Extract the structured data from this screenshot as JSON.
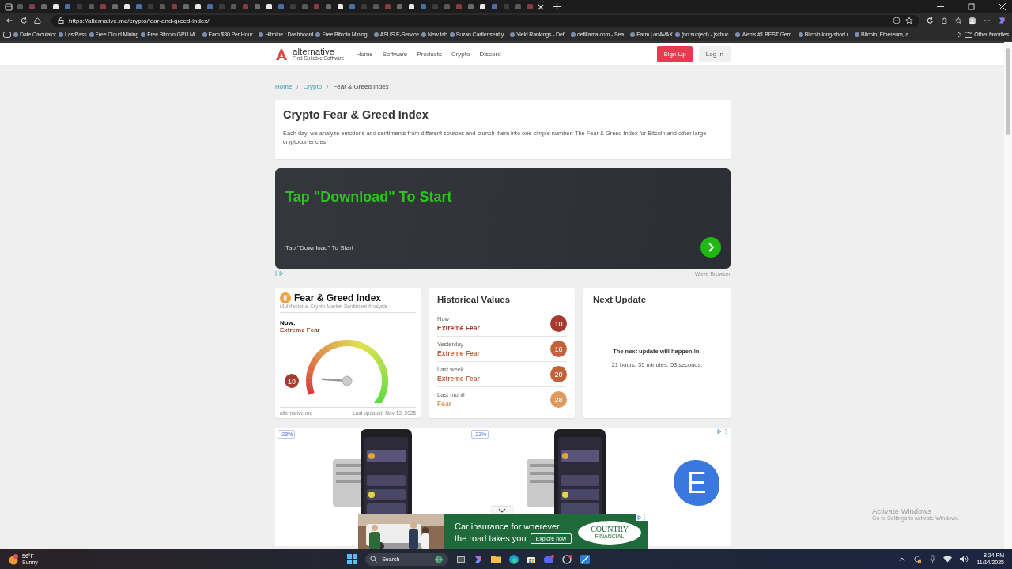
{
  "browser": {
    "url": "https://alternative.me/crypto/fear-and-greed-index/",
    "bookmarks": [
      "Date Calculator",
      "LastPass",
      "Free Cloud Mining",
      "Free Bitcoin GPU Mi...",
      "Earn $30 Per Hour...",
      "Hitmine : Dashboard",
      "Free Bitcoin Mining...",
      "ASUS E-Service",
      "New tab",
      "Suzan Cartier sent y...",
      "Yield Rankings - Def...",
      "defillama.com - Sea...",
      "Farm | onAVAX",
      "(no subject) - jschuc...",
      "Web's #1 BEST Gem...",
      "Bitcoin long-short r...",
      "Bitcoin, Ethereum, a..."
    ],
    "other_favorites": "Other favorites"
  },
  "site": {
    "logo": "alternative",
    "tagline": "Find Suitable Software",
    "nav": [
      "Home",
      "Software",
      "Products",
      "Crypto",
      "Discord"
    ],
    "sign_up": "Sign Up",
    "log_in": "Log In"
  },
  "breadcrumb": [
    {
      "label": "Home",
      "kind": "link"
    },
    {
      "label": "/",
      "kind": "separator"
    },
    {
      "label": "Crypto",
      "kind": "link"
    },
    {
      "label": "/",
      "kind": "separator"
    },
    {
      "label": "Fear & Greed Index",
      "kind": "current"
    }
  ],
  "intro": {
    "title": "Crypto Fear & Greed Index",
    "text": "Each day, we analyze emotions and sentiments from different sources and crunch them into one simple number: The Fear & Greed Index for Bitcoin and other large cryptocurrencies."
  },
  "banner_ad": {
    "heading": "Tap \"Download\" To Start",
    "text": "Tap \"Download\" To Start",
    "sponsor": "Wave Browser"
  },
  "fear_greed": {
    "title": "Fear & Greed Index",
    "subtitle": "Multifactorial Crypto Market Sentiment Analysis",
    "now_label": "Now:",
    "classification": "Extreme Fear",
    "value": "10",
    "source": "alternative.me",
    "updated": "Last updated: Nov 13, 2025"
  },
  "historical": {
    "title": "Historical Values",
    "rows": [
      {
        "period": "Now",
        "classification": "Extreme Fear",
        "value": "10",
        "color": "#a63a2e"
      },
      {
        "period": "Yesterday",
        "classification": "Extreme Fear",
        "value": "16",
        "color": "#c2613a"
      },
      {
        "period": "Last week",
        "classification": "Extreme Fear",
        "value": "20",
        "color": "#c2613a"
      },
      {
        "period": "Last month",
        "classification": "Fear",
        "value": "28",
        "color": "#df9a5e"
      }
    ]
  },
  "next_update": {
    "title": "Next Update",
    "label": "The next update will happen in:",
    "countdown": "21 hours, 35 minutes, 53 seconds."
  },
  "product_ads": [
    {
      "discount": "-23%"
    },
    {
      "discount": "-23%"
    }
  ],
  "ad_logo": "E",
  "overlay_ad": {
    "lines": [
      "Car insurance for wherever",
      "the road takes you"
    ],
    "button": "Explore now",
    "brand": "COUNTRY",
    "brand_sub": "FINANCIAL"
  },
  "watermark": {
    "title": "Activate Windows",
    "text": "Go to Settings to activate Windows."
  },
  "taskbar": {
    "temperature": "56°F",
    "weather": "Sunny",
    "search": "Search",
    "time": "8:24 PM",
    "date": "11/14/2025"
  }
}
